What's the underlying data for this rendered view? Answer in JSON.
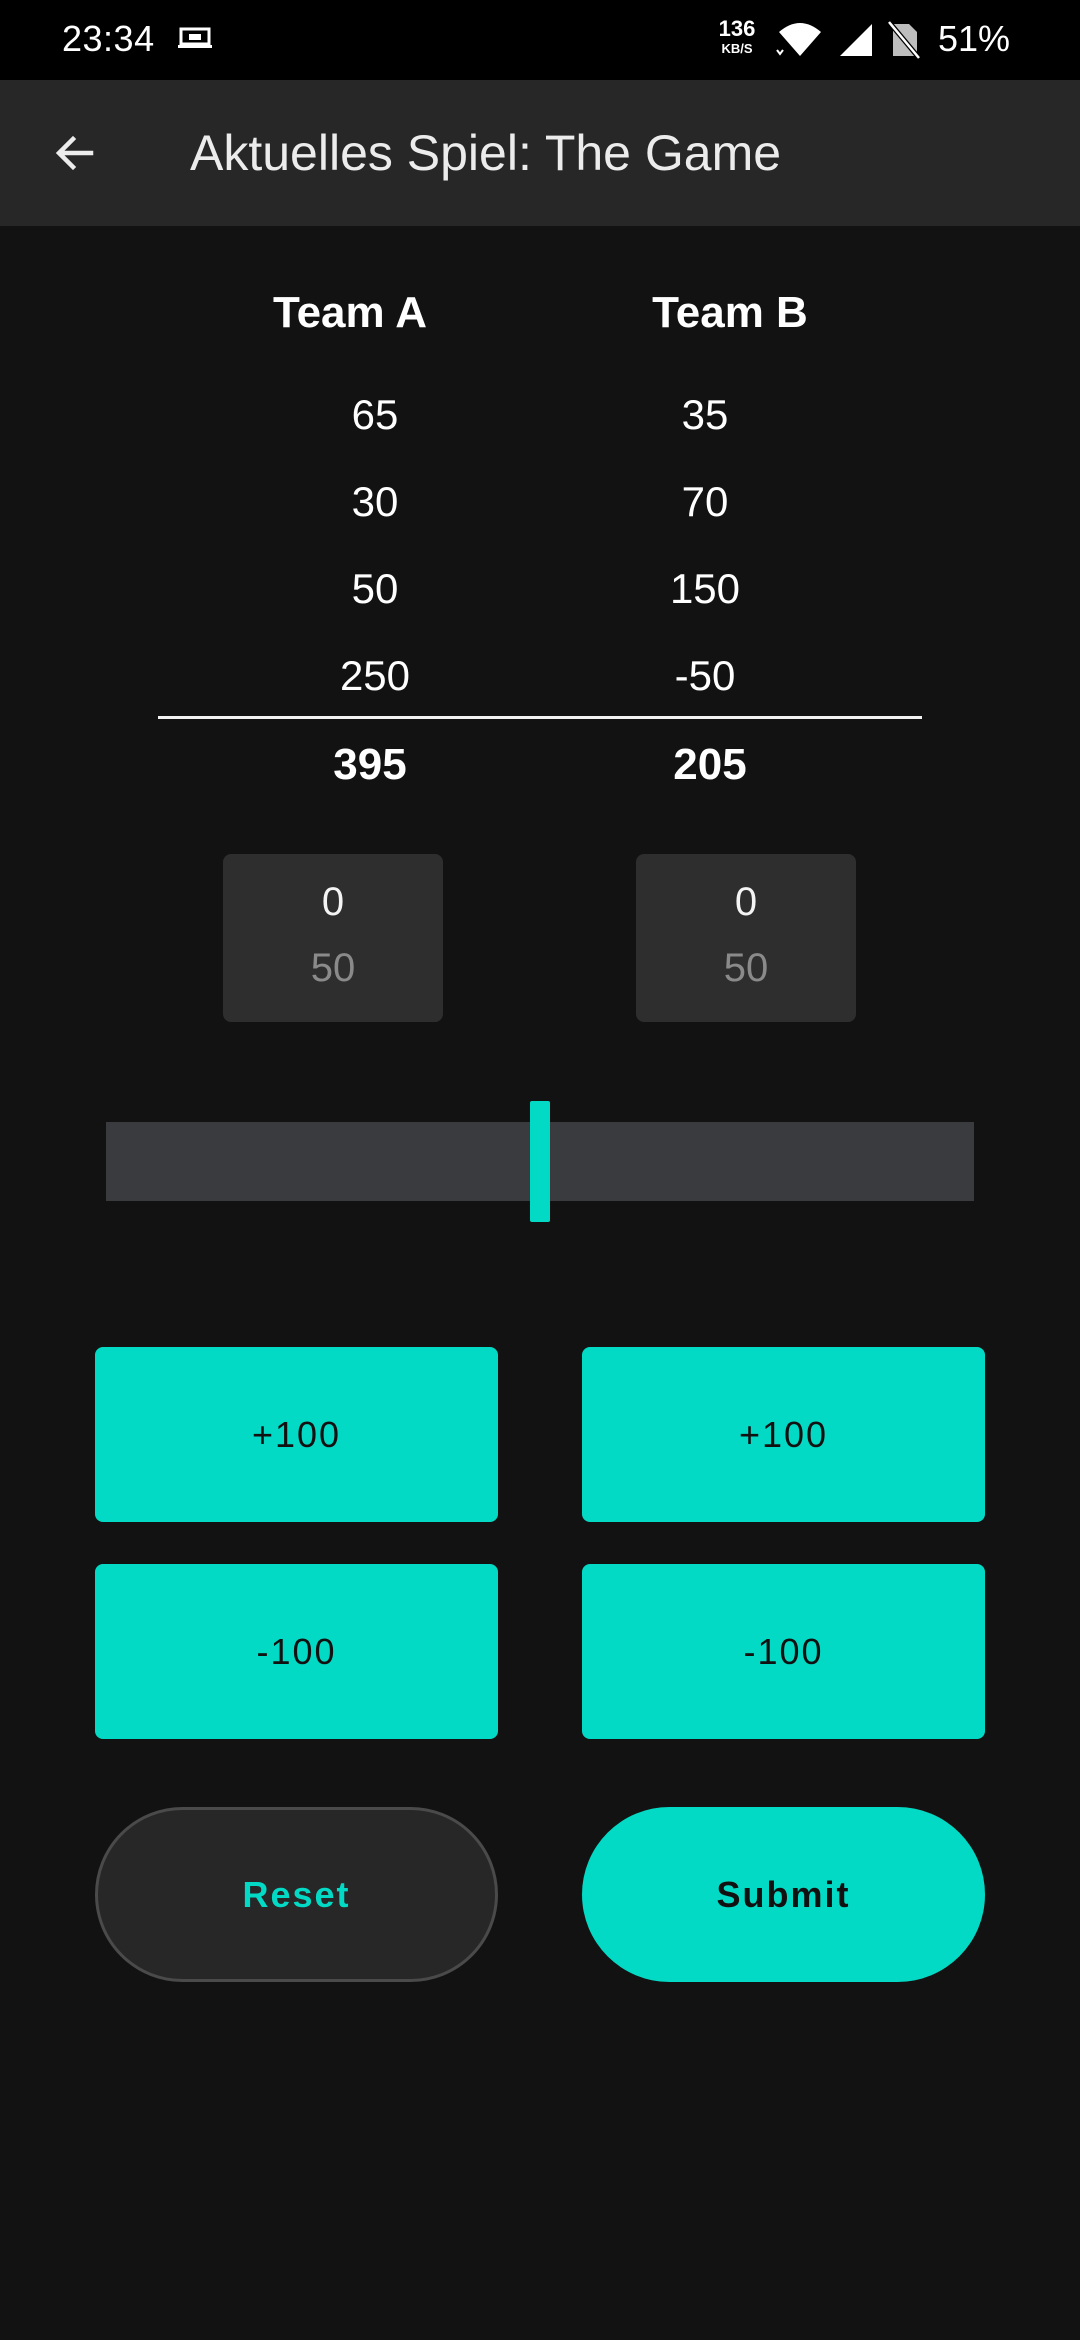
{
  "status_bar": {
    "time": "23:34",
    "screen_icon": "screen-share-icon",
    "network_speed_value": "136",
    "network_speed_unit": "KB/S",
    "wifi_icon": "wifi-icon",
    "signal_icon": "cell-signal-icon",
    "sim_icon": "no-sim-icon",
    "battery": "51%"
  },
  "app_bar": {
    "back_icon": "arrow-back-icon",
    "title": "Aktuelles Spiel: The Game"
  },
  "teams": {
    "a": {
      "name": "Team A",
      "scores": [
        "65",
        "30",
        "50",
        "250"
      ],
      "total": "395"
    },
    "b": {
      "name": "Team B",
      "scores": [
        "35",
        "70",
        "150",
        "-50"
      ],
      "total": "205"
    }
  },
  "pickers": {
    "a": {
      "current": "0",
      "next": "50"
    },
    "b": {
      "current": "0",
      "next": "50"
    }
  },
  "slider": {
    "value_fraction": 0.5
  },
  "buttons": {
    "a_plus": "+100",
    "b_plus": "+100",
    "a_minus": "-100",
    "b_minus": "-100",
    "reset": "Reset",
    "submit": "Submit"
  },
  "colors": {
    "accent": "#03dac5",
    "background": "#121212",
    "surface": "#272727"
  }
}
